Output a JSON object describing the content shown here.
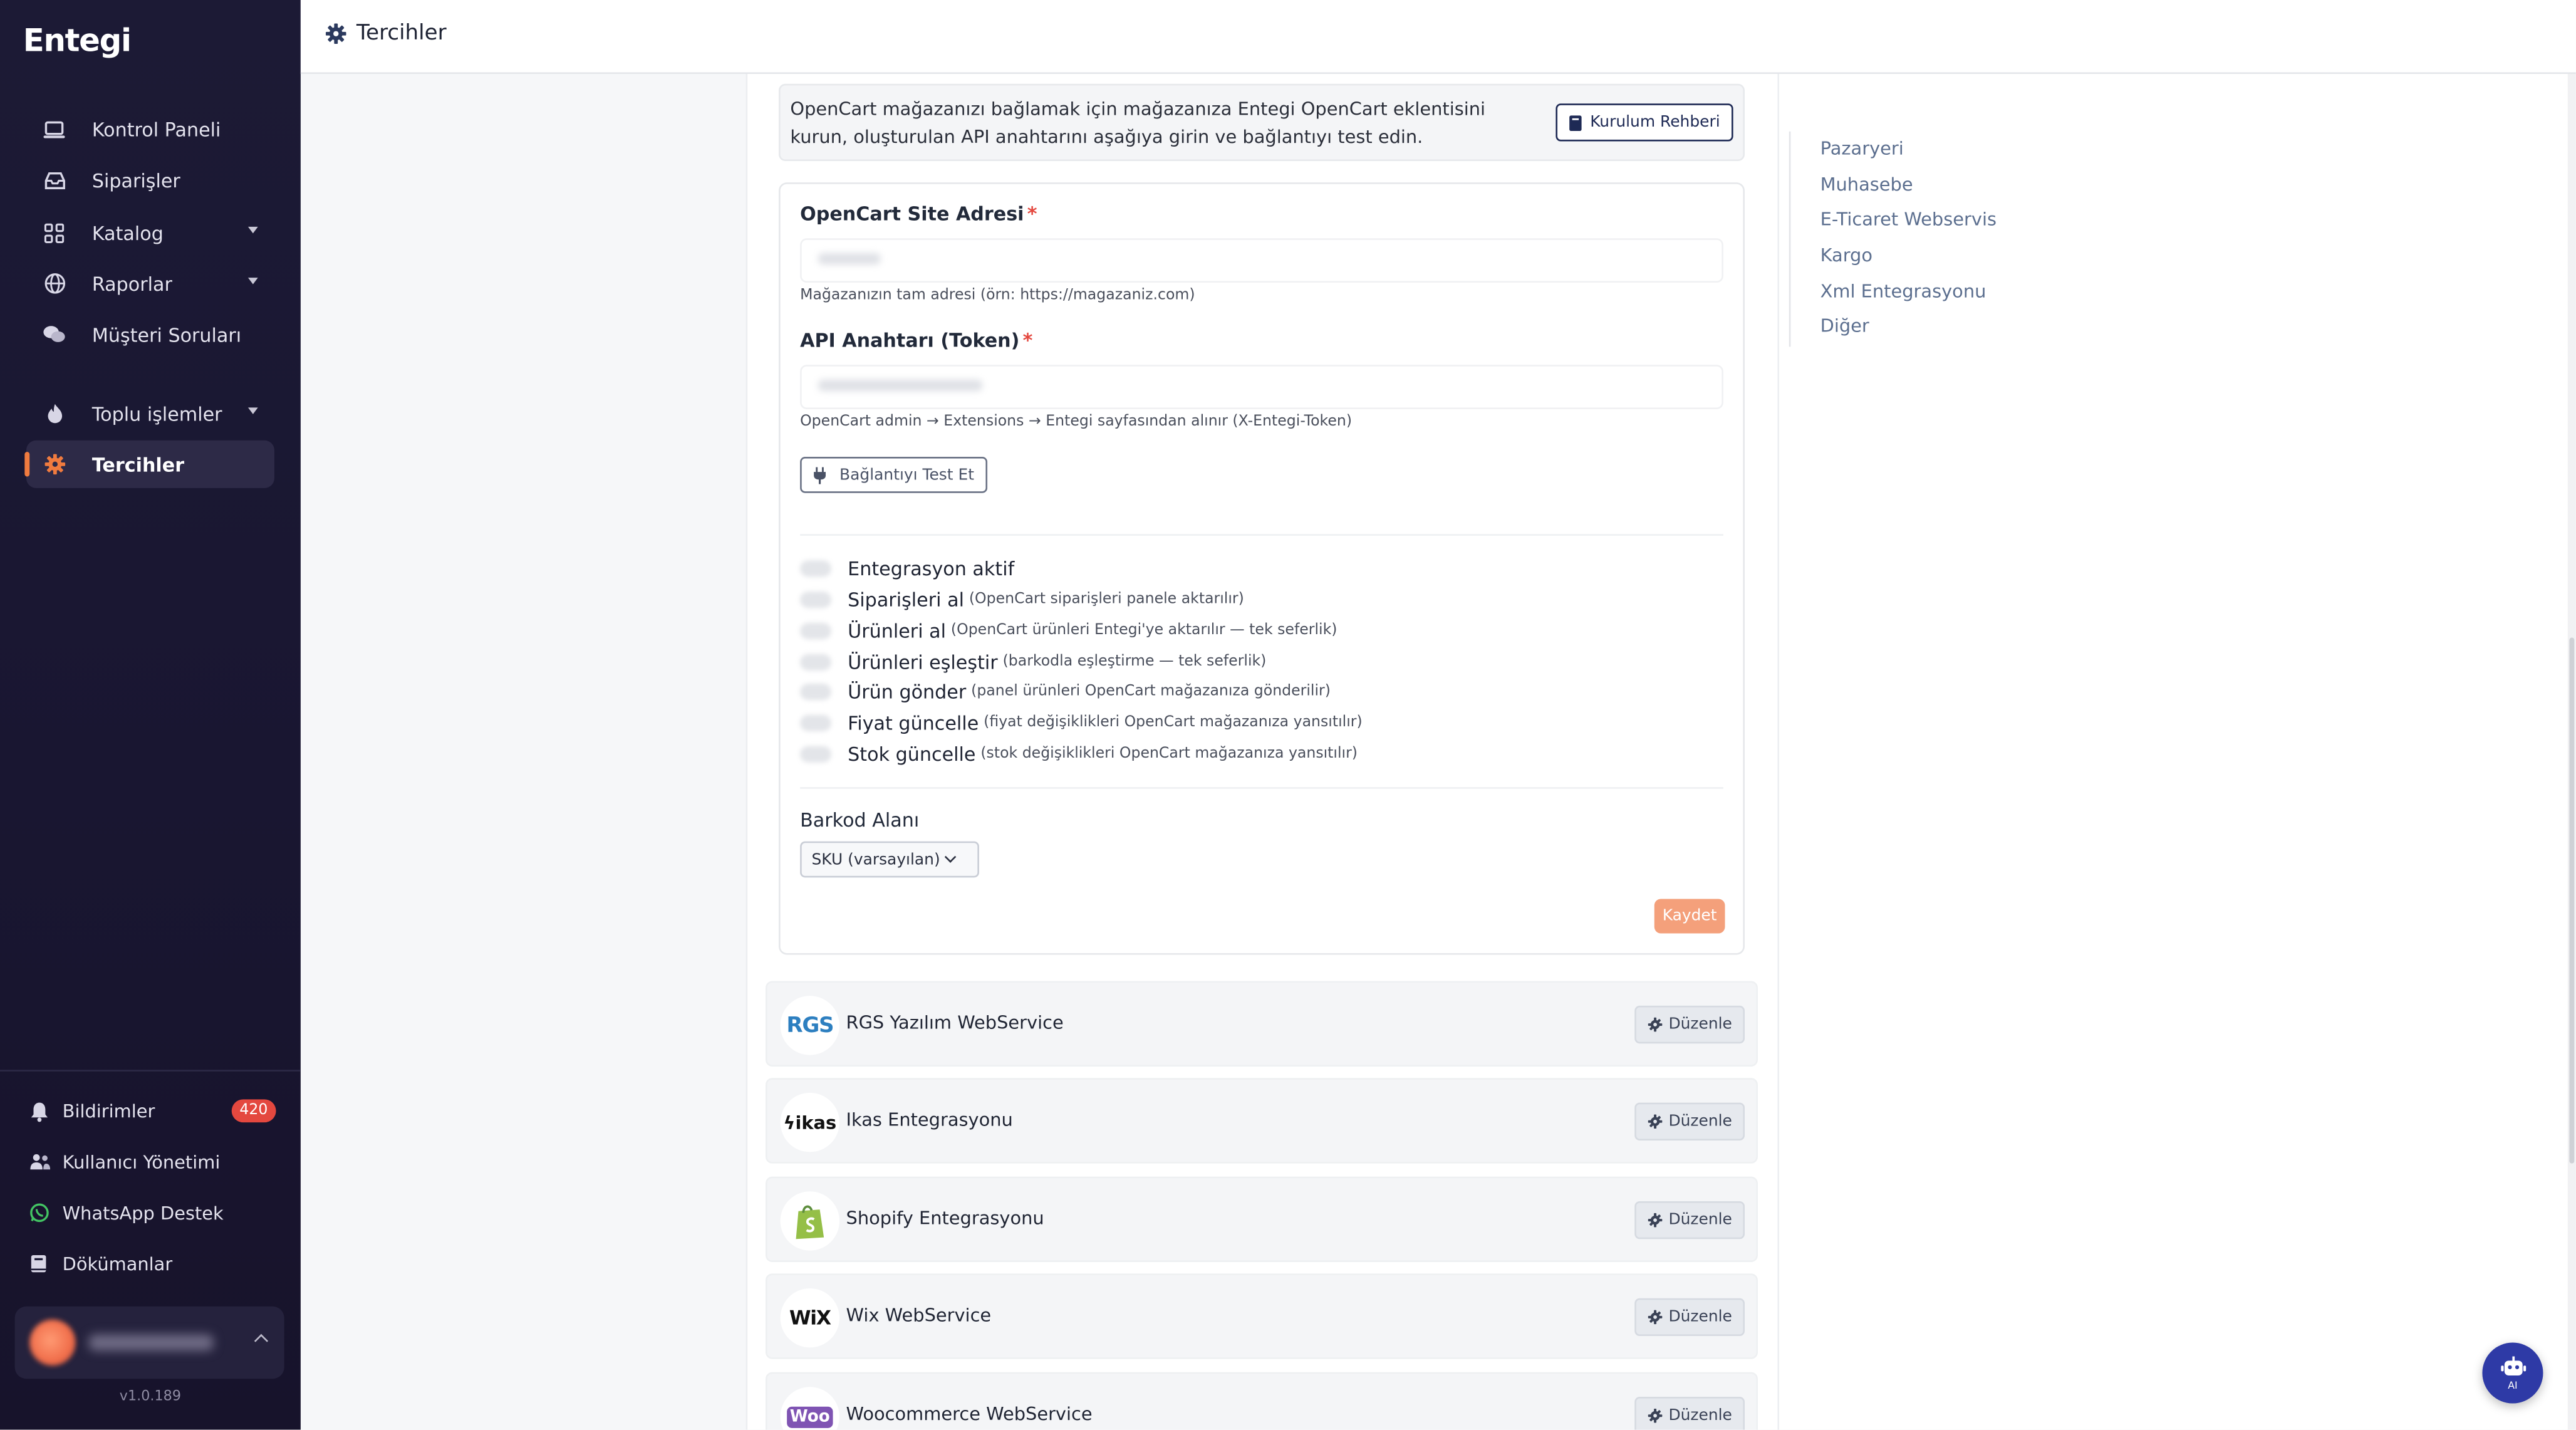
{
  "app": {
    "logo_text": "Entegi",
    "version": "v1.0.189"
  },
  "header": {
    "title": "Tercihler"
  },
  "sidebar": {
    "items": [
      {
        "label": "Kontrol Paneli",
        "icon": "laptop-icon",
        "caret": false
      },
      {
        "label": "Siparişler",
        "icon": "inbox-icon",
        "caret": false
      },
      {
        "label": "Katalog",
        "icon": "grid-icon",
        "caret": true
      },
      {
        "label": "Raporlar",
        "icon": "globe-icon",
        "caret": true
      },
      {
        "label": "Müşteri Soruları",
        "icon": "chat-icon",
        "caret": false
      },
      {
        "label": "Toplu işlemler",
        "icon": "fire-icon",
        "caret": true
      },
      {
        "label": "Tercihler",
        "icon": "gear-icon",
        "caret": false,
        "active": true
      }
    ],
    "bottom": [
      {
        "label": "Bildirimler",
        "icon": "bell-icon",
        "badge": "420"
      },
      {
        "label": "Kullanıcı Yönetimi",
        "icon": "users-icon"
      },
      {
        "label": "WhatsApp Destek",
        "icon": "whatsapp-icon"
      },
      {
        "label": "Dökümanlar",
        "icon": "book-icon"
      }
    ],
    "user": {
      "name": ""
    }
  },
  "opencart": {
    "info_text": "OpenCart mağazanızı bağlamak için mağazanıza Entegi OpenCart eklentisini kurun, oluşturulan API anahtarını aşağıya girin ve bağlantıyı test edin.",
    "guide_button": "Kurulum Rehberi",
    "site_label": "OpenCart Site Adresi",
    "required_mark": "*",
    "site_hint": "Mağazanızın tam adresi (örn: https://magazaniz.com)",
    "token_label": "API Anahtarı (Token)",
    "token_hint": "OpenCart admin → Extensions → Entegi sayfasından alınır (X-Entegi-Token)",
    "test_button": "Bağlantıyı Test Et",
    "toggles": [
      {
        "label": "Entegrasyon aktif",
        "desc": ""
      },
      {
        "label": "Siparişleri al",
        "desc": "(OpenCart siparişleri panele aktarılır)"
      },
      {
        "label": "Ürünleri al",
        "desc": "(OpenCart ürünleri Entegi'ye aktarılır — tek seferlik)"
      },
      {
        "label": "Ürünleri eşleştir",
        "desc": "(barkodla eşleştirme — tek seferlik)"
      },
      {
        "label": "Ürün gönder",
        "desc": "(panel ürünleri OpenCart mağazanıza gönderilir)"
      },
      {
        "label": "Fiyat güncelle",
        "desc": "(fiyat değişiklikleri OpenCart mağazanıza yansıtılır)"
      },
      {
        "label": "Stok güncelle",
        "desc": "(stok değişiklikleri OpenCart mağazanıza yansıtılır)"
      }
    ],
    "barcode_label": "Barkod Alanı",
    "barcode_selected": "SKU (varsayılan)",
    "save_button": "Kaydet"
  },
  "integrations": [
    {
      "name": "RGS Yazılım WebService",
      "logo_text": "RGS",
      "button": "Düzenle"
    },
    {
      "name": "Ikas Entegrasyonu",
      "logo_text": "ikas",
      "button": "Düzenle"
    },
    {
      "name": "Shopify Entegrasyonu",
      "logo_text": "",
      "button": "Düzenle"
    },
    {
      "name": "Wix WebService",
      "logo_text": "WiX",
      "button": "Düzenle"
    },
    {
      "name": "Woocommerce WebService",
      "logo_text": "Woo",
      "button": "Düzenle"
    }
  ],
  "right_nav": [
    "Pazaryeri",
    "Muhasebe",
    "E-Ticaret Webservis",
    "Kargo",
    "Xml Entegrasyonu",
    "Diğer"
  ],
  "ai_button": {
    "label": "AI"
  },
  "colors": {
    "accent": "#f07b3f",
    "sidebar_bg": "#1c1a35",
    "link": "#5c6f8f",
    "badge": "#e4483f",
    "ai": "#2e3aa6"
  }
}
